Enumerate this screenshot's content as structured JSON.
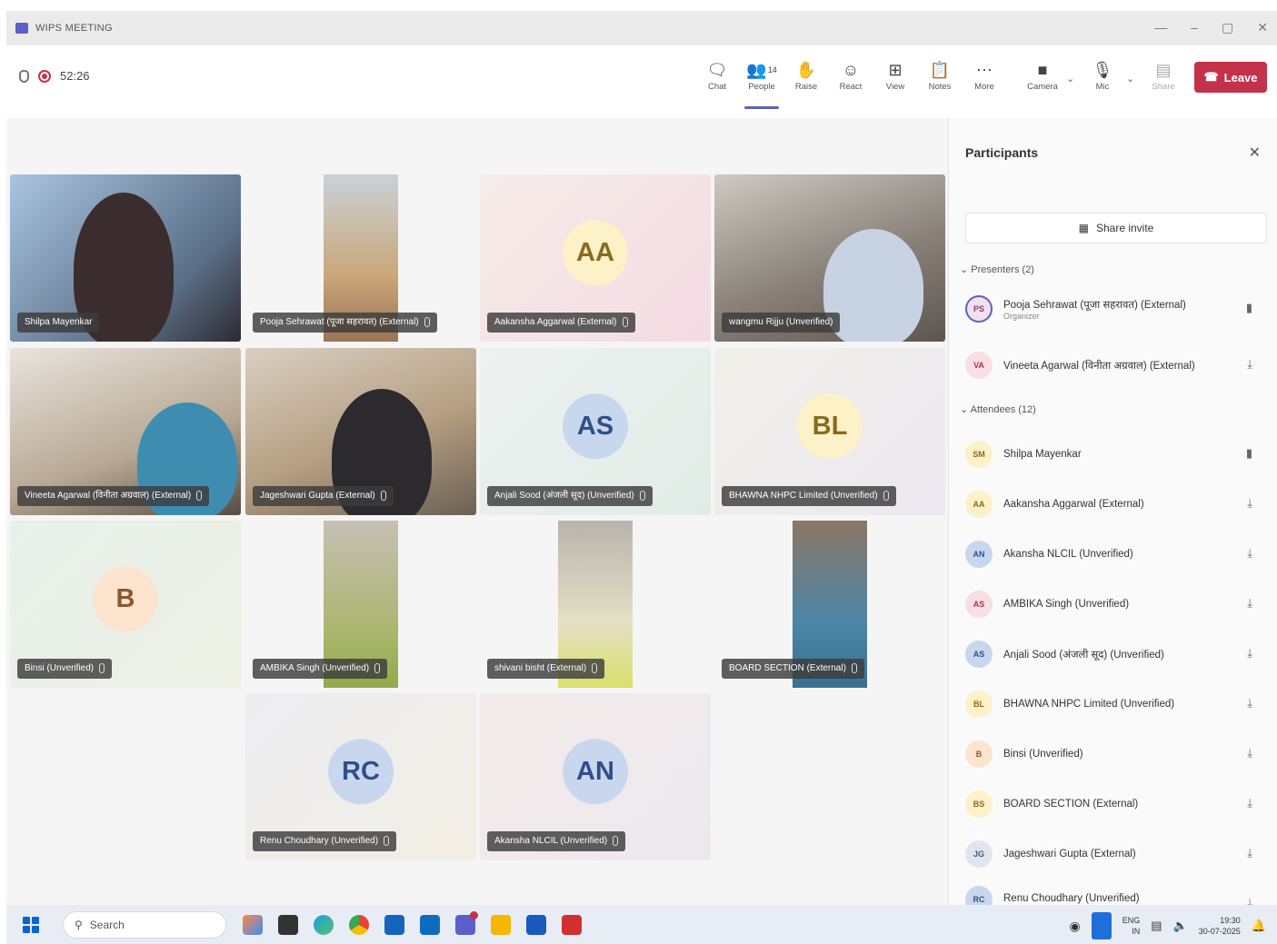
{
  "window": {
    "title": "WIPS MEETING",
    "controls": [
      "—",
      "–",
      "▢",
      "✕"
    ]
  },
  "toolbar": {
    "timer": "52:26",
    "buttons": [
      {
        "label": "Chat",
        "icon": "chat-icon"
      },
      {
        "label": "People",
        "icon": "people-icon",
        "badge": "14"
      },
      {
        "label": "Raise",
        "icon": "hand-icon"
      },
      {
        "label": "React",
        "icon": "smile-icon"
      },
      {
        "label": "View",
        "icon": "grid-icon"
      },
      {
        "label": "Notes",
        "icon": "notes-icon"
      },
      {
        "label": "More",
        "icon": "more-icon"
      },
      {
        "label": "Camera",
        "icon": "camera-icon"
      },
      {
        "label": "Mic",
        "icon": "mic-icon"
      },
      {
        "label": "Share",
        "icon": "share-icon"
      }
    ],
    "leave_label": "Leave",
    "colors": {
      "accent": "#5b5fc7",
      "leave": "#c4314b"
    }
  },
  "tiles": [
    {
      "name": "Shilpa Mayenkar",
      "type": "video"
    },
    {
      "name": "Pooja Sehrawat (पूजा सहरावत) (External)",
      "type": "video"
    },
    {
      "name": "Aakansha Aggarwal (External)",
      "type": "avatar",
      "initials": "AA"
    },
    {
      "name": "wangmu Rijju (Unverified)",
      "type": "video"
    },
    {
      "name": "Vineeta Agarwal (विनीता अग्रवाल) (External)",
      "type": "video"
    },
    {
      "name": "Jageshwari Gupta (External)",
      "type": "video"
    },
    {
      "name": "Anjali Sood (अंजली सूद) (Unverified)",
      "type": "avatar",
      "initials": "AS"
    },
    {
      "name": "BHAWNA NHPC Limited (Unverified)",
      "type": "avatar",
      "initials": "BL"
    },
    {
      "name": "Binsi (Unverified)",
      "type": "avatar",
      "initials": "B"
    },
    {
      "name": "AMBIKA Singh (Unverified)",
      "type": "video"
    },
    {
      "name": "shivani bisht (External)",
      "type": "video"
    },
    {
      "name": "BOARD SECTION (External)",
      "type": "video"
    },
    {
      "name": "Renu Choudhary (Unverified)",
      "type": "avatar",
      "initials": "RC"
    },
    {
      "name": "Akansha NLCIL (Unverified)",
      "type": "avatar",
      "initials": "AN"
    }
  ],
  "panel": {
    "title": "Participants",
    "share_invite": "Share invite",
    "presenters_label": "Presenters (2)",
    "attendees_label": "Attendees (12)",
    "presenters": [
      {
        "initials": "PS",
        "name": "Pooja Sehrawat (पूजा सहरावत) (External)",
        "role": "Organizer"
      },
      {
        "initials": "VA",
        "name": "Vineeta Agarwal (विनीता अग्रवाल) (External)"
      }
    ],
    "attendees": [
      {
        "initials": "SM",
        "name": "Shilpa Mayenkar"
      },
      {
        "initials": "AA",
        "name": "Aakansha Aggarwal (External)"
      },
      {
        "initials": "AN",
        "name": "Akansha NLCIL (Unverified)"
      },
      {
        "initials": "AS",
        "name": "AMBIKA Singh (Unverified)"
      },
      {
        "initials": "AS",
        "name": "Anjali Sood (अंजली सूद) (Unverified)"
      },
      {
        "initials": "BL",
        "name": "BHAWNA NHPC Limited (Unverified)"
      },
      {
        "initials": "B",
        "name": "Binsi (Unverified)"
      },
      {
        "initials": "BS",
        "name": "BOARD SECTION (External)"
      },
      {
        "initials": "JG",
        "name": "Jageshwari Gupta (External)"
      },
      {
        "initials": "RC",
        "name": "Renu Choudhary (Unverified)"
      }
    ]
  },
  "taskbar": {
    "search_placeholder": "Search",
    "lang_top": "ENG",
    "lang_bottom": "IN",
    "time": "19:30",
    "date": "30-07-2025"
  }
}
